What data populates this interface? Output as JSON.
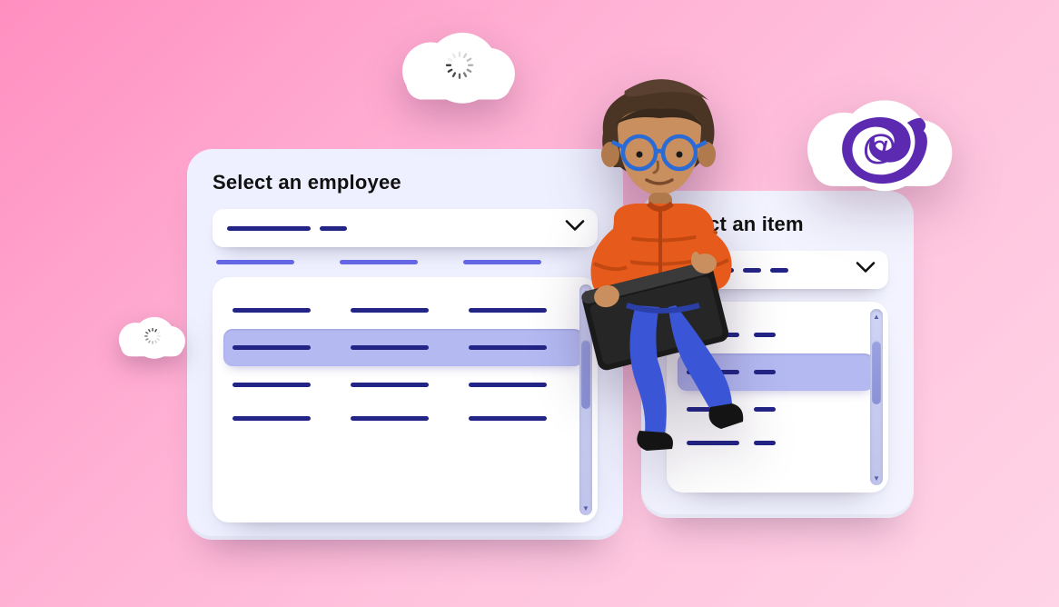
{
  "cards": {
    "employee": {
      "title": "Select an employee"
    },
    "item": {
      "title": "Select an item"
    }
  },
  "icons": {
    "chevron_down": "chevron-down-icon",
    "spinner": "loading-spinner-icon",
    "blazor": "blazor-logo-icon"
  },
  "colors": {
    "accent": "#222486",
    "accent_light": "#4c4fe1",
    "highlight": "#b4b9f2",
    "card_bg": "#eef0ff",
    "blazor": "#5b2ab0"
  }
}
